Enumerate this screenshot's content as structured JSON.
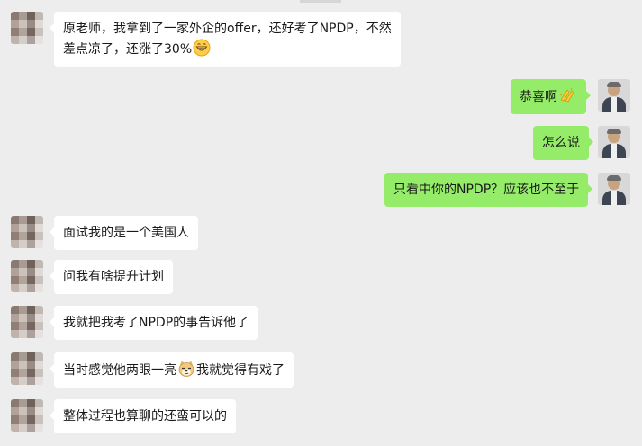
{
  "messages": [
    {
      "side": "left",
      "line1": "原老师，我拿到了一家外企的offer，还好考了NPDP，不然",
      "line2": "差点凉了，还涨了30%",
      "emoji": "grinning-face-emoji"
    },
    {
      "side": "right",
      "text": "恭喜啊",
      "emoji": "clapping-hands-emoji"
    },
    {
      "side": "right",
      "text": "怎么说"
    },
    {
      "side": "right",
      "text": "只看中你的NPDP？应该也不至于"
    },
    {
      "side": "left",
      "text": "面试我的是一个美国人"
    },
    {
      "side": "left",
      "text": "问我有啥提升计划"
    },
    {
      "side": "left",
      "text": "我就把我考了NPDP的事告诉他了"
    },
    {
      "side": "left",
      "before": "当时感觉他两眼一亮",
      "after": "我就觉得有戏了",
      "emoji": "doge-emoji"
    },
    {
      "side": "left",
      "text": "整体过程也算聊的还蛮可以的"
    }
  ],
  "colors": {
    "background": "#ededed",
    "incoming_bubble": "#ffffff",
    "outgoing_bubble": "#95ec69"
  }
}
